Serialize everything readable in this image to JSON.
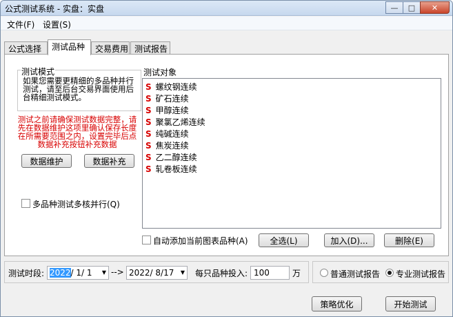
{
  "window": {
    "title": "公式测试系统 - 实盘：实盘"
  },
  "menu": [
    {
      "label": "文件(F)"
    },
    {
      "label": "设置(S)"
    }
  ],
  "tabs": [
    {
      "label": "公式选择"
    },
    {
      "label": "测试品种"
    },
    {
      "label": "交易费用"
    },
    {
      "label": "测试报告"
    }
  ],
  "mode": {
    "title": "测试模式",
    "description": "如果您需要更精细的多品种并行测试，请至后台交易界面使用后台精细测试模式。"
  },
  "warning": "测试之前请确保测试数据完整，请先在数据维护这项里确认保存长度在所需要范围之内，设置完毕后点数据补充按钮补充数据",
  "buttons": {
    "data_maintain": "数据维护",
    "data_supplement": "数据补充",
    "select_all": "全选(L)",
    "add": "加入(D)...",
    "delete": "删除(E)",
    "optimize": "策略优化",
    "start": "开始测试"
  },
  "multicore": {
    "label": "多品种测试多核并行(Q)",
    "checked": false
  },
  "objects": {
    "title": "测试对象",
    "items": [
      {
        "prefix": "S",
        "name": "螺纹钢连续"
      },
      {
        "prefix": "S",
        "name": "矿石连续"
      },
      {
        "prefix": "S",
        "name": "甲醇连续"
      },
      {
        "prefix": "S",
        "name": "聚氯乙烯连续"
      },
      {
        "prefix": "S",
        "name": "纯碱连续"
      },
      {
        "prefix": "S",
        "name": "焦炭连续"
      },
      {
        "prefix": "S",
        "name": "乙二醇连续"
      },
      {
        "prefix": "S",
        "name": "轧卷板连续"
      }
    ],
    "auto_add": {
      "label": "自动添加当前图表品种(A)",
      "checked": false
    }
  },
  "period": {
    "label": "测试时段:",
    "start_year": "2022",
    "start_rest": "/ 1/ 1",
    "arrow": "-->",
    "end": "2022/ 8/17",
    "invest_label": "每只品种投入:",
    "invest_value": "100",
    "unit": "万"
  },
  "report": {
    "normal": {
      "label": "普通测试报告",
      "selected": false
    },
    "pro": {
      "label": "专业测试报告",
      "selected": true
    }
  }
}
